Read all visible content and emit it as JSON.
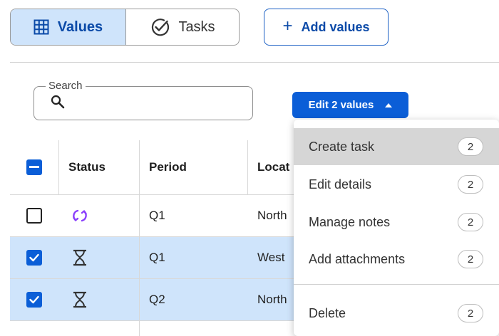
{
  "toggle": {
    "values_label": "Values",
    "tasks_label": "Tasks"
  },
  "add_values_label": "Add values",
  "search": {
    "label": "Search",
    "placeholder": ""
  },
  "edit_button_label": "Edit 2 values",
  "table": {
    "headers": {
      "status": "Status",
      "period": "Period",
      "location": "Locat"
    },
    "rows": [
      {
        "selected": false,
        "status_icon": "sync-icon",
        "period": "Q1",
        "location": "North"
      },
      {
        "selected": true,
        "status_icon": "hourglass-icon",
        "period": "Q1",
        "location": "West"
      },
      {
        "selected": true,
        "status_icon": "hourglass-icon",
        "period": "Q2",
        "location": "North"
      }
    ]
  },
  "menu": {
    "items": [
      {
        "label": "Create task",
        "count": "2"
      },
      {
        "label": "Edit details",
        "count": "2"
      },
      {
        "label": "Manage notes",
        "count": "2"
      },
      {
        "label": "Add attachments",
        "count": "2"
      },
      {
        "label": "Delete",
        "count": "2"
      }
    ]
  },
  "colors": {
    "accent": "#0b5ed7",
    "selected_row": "#cfe4fb",
    "sync_icon": "#8a3ffc",
    "menu_highlight": "#d6d6d6"
  }
}
